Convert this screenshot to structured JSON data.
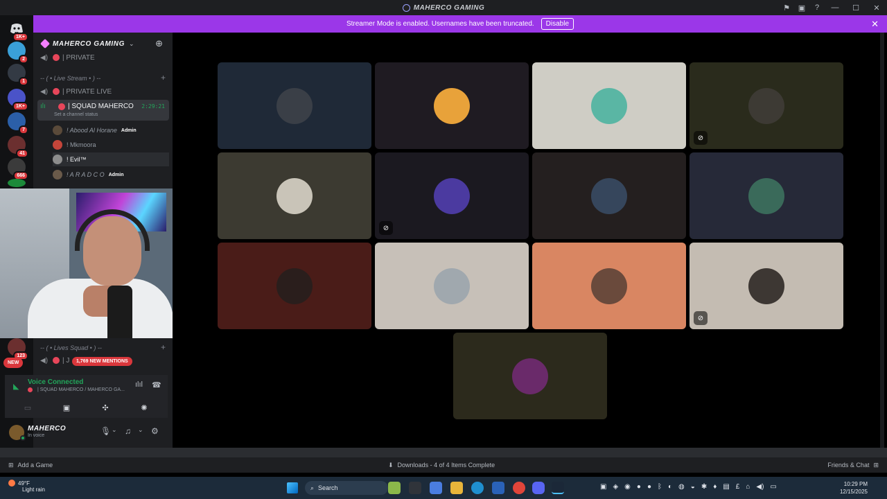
{
  "window": {
    "title": "MAHERCO GAMING"
  },
  "banner": {
    "text": "Streamer Mode is enabled. Usernames have been truncated.",
    "button": "Disable",
    "close": "✕"
  },
  "rail": {
    "badges": [
      "1K+",
      "2",
      "1",
      "1K+",
      "7",
      "41",
      "666",
      "123",
      "NEW"
    ],
    "colors": [
      "#5865f2",
      "#3aa0d8",
      "#333a44",
      "#4a53c8",
      "#2b5fa8",
      "#6b2f2f",
      "#3b3b3b",
      "#1c8a3a"
    ]
  },
  "sidebar": {
    "server_name": "MAHERCO GAMING",
    "channels": {
      "private": "| PRIVATE",
      "cat_live_stream": "-- ( • Live Stream • ) -- ",
      "private_live": "| PRIVATE LIVE",
      "active": {
        "name": "| SQUAD MAHERCO",
        "time": "2:29:21",
        "status": "Set a channel status"
      },
      "cat_lives_squad": "-- ( • Lives Squad • ) --",
      "squad_row_name": "| J"
    },
    "members": [
      {
        "name": "! Abood Al Horane",
        "tag": "Admin"
      },
      {
        "name": "! Mkmoora",
        "tag": ""
      },
      {
        "name": "! Evil™",
        "tag": ""
      },
      {
        "name": "! A R A D C O",
        "tag": "Admin"
      }
    ],
    "mentions": "1,769 NEW MENTIONS",
    "new_pill": "NEW"
  },
  "voice": {
    "status": "Voice Connected",
    "channel": "| SQUAD MAHERCO / MAHERCO GA..."
  },
  "user": {
    "name": "MAHERCO",
    "status": "In voice"
  },
  "stage": {
    "tiles": [
      {
        "bg": "#1f2937",
        "pfp": "#3a3f47"
      },
      {
        "bg": "#1f1b22",
        "pfp": "#e8a23a"
      },
      {
        "bg": "#cfcdc5",
        "pfp": "#5ab6a4"
      },
      {
        "bg": "#2a2b1c",
        "pfp": "#3d3a34",
        "muted": true
      },
      {
        "bg": "#3c3a31",
        "pfp": "#c9c4b8"
      },
      {
        "bg": "#1b1920",
        "pfp": "#4b3aa0",
        "muted": true
      },
      {
        "bg": "#241f1f",
        "pfp": "#36465c"
      },
      {
        "bg": "#262938",
        "pfp": "#3a6a5a"
      },
      {
        "bg": "#4a1c18",
        "pfp": "#2a1e1c"
      },
      {
        "bg": "#c7c0b8",
        "pfp": "#a0a8ae"
      },
      {
        "bg": "#d98662",
        "pfp": "#6a4a3c"
      },
      {
        "bg": "#c4bcb2",
        "pfp": "#3d3733",
        "muted": true
      },
      {
        "bg": "#2c2a1c",
        "pfp": "#6a2a6a"
      }
    ]
  },
  "bottom": {
    "add_game": "Add a Game",
    "downloads": "Downloads - 4 of 4 Items Complete",
    "friends": "Friends & Chat"
  },
  "taskbar": {
    "weather_temp": "49°F",
    "weather_text": "Light rain",
    "search": "Search",
    "time": "10:29 PM",
    "date": "12/15/2025"
  }
}
